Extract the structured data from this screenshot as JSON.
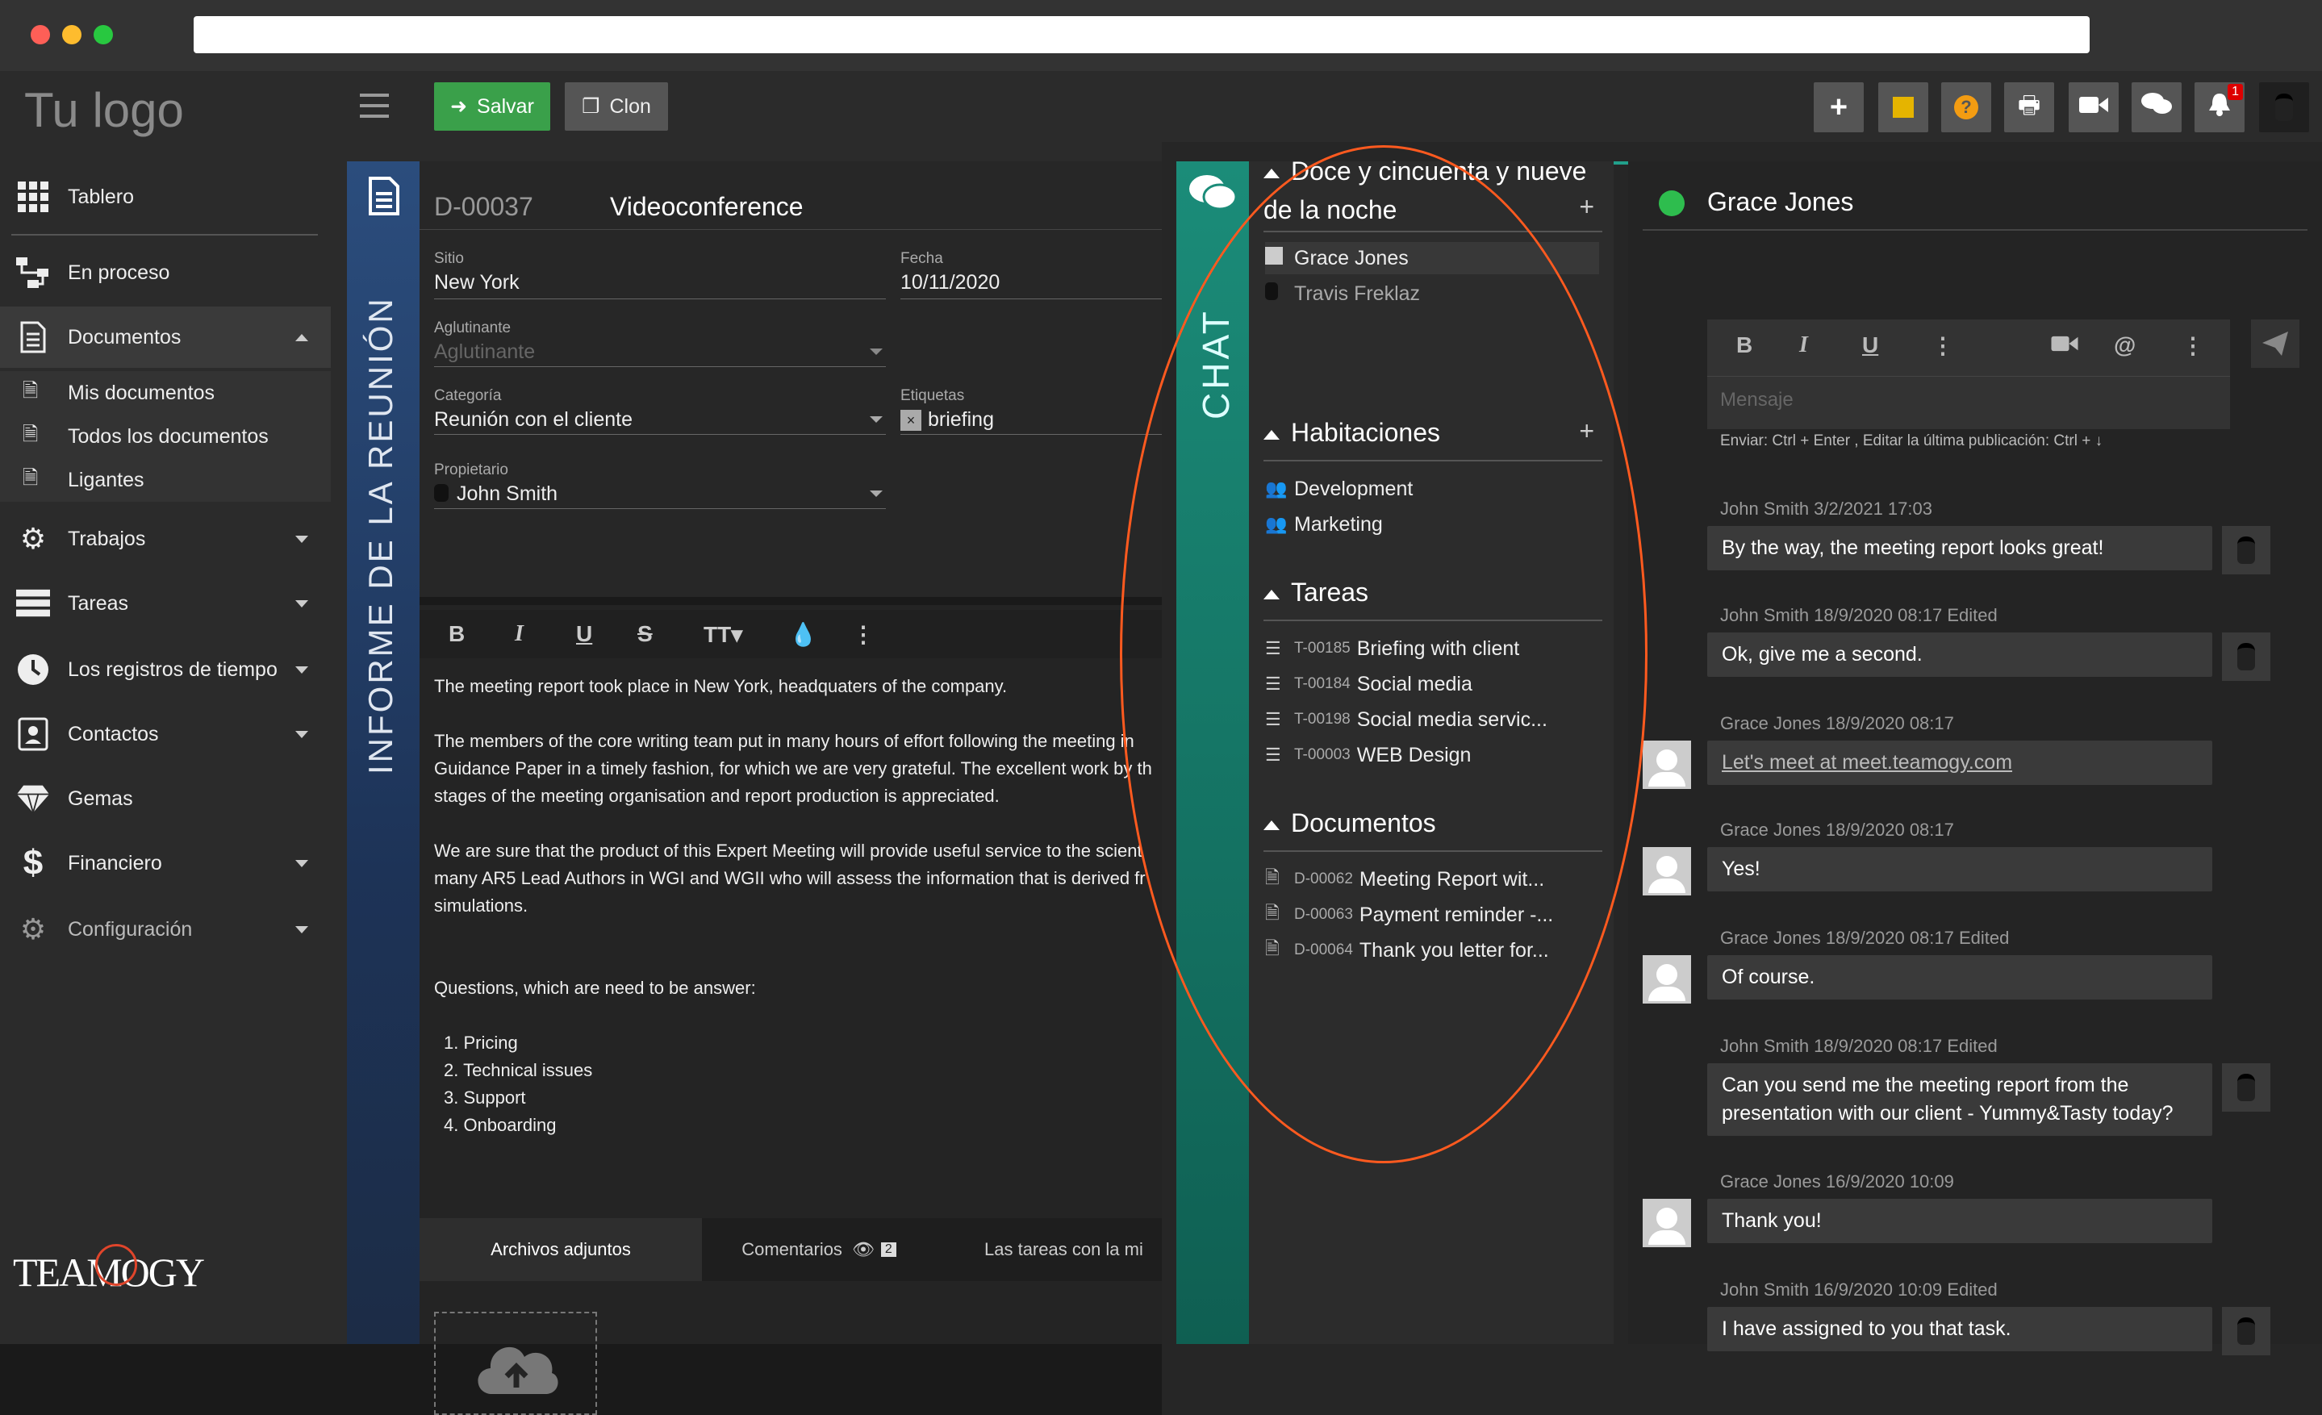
{
  "logo": "Tu logo",
  "brand": "TEAMOGY",
  "nav": {
    "tablero": "Tablero",
    "en_proceso": "En proceso",
    "documentos": "Documentos",
    "mis_documentos": "Mis documentos",
    "todos": "Todos los documentos",
    "ligantes": "Ligantes",
    "trabajos": "Trabajos",
    "tareas": "Tareas",
    "registros": "Los registros de tiempo",
    "contactos": "Contactos",
    "gemas": "Gemas",
    "financiero": "Financiero",
    "config": "Configuración"
  },
  "toolbar": {
    "save": "Salvar",
    "clone": "Clon",
    "notif_count": "1"
  },
  "doc": {
    "vertical_title": "INFORME DE LA REUNIÓN",
    "id": "D-00037",
    "title": "Videoconference",
    "sitio_label": "Sitio",
    "sitio": "New York",
    "fecha_label": "Fecha",
    "fecha": "10/11/2020",
    "aglutinante_label": "Aglutinante",
    "aglutinante_ph": "Aglutinante",
    "categoria_label": "Categoría",
    "categoria": "Reunión con el cliente",
    "etiquetas_label": "Etiquetas",
    "etiqueta": "briefing",
    "propietario_label": "Propietario",
    "propietario": "John Smith",
    "p1": "The meeting report took place in New York, headquaters of the company.",
    "p2a": " The members of the core writing team put in many hours of effort following the meeting in",
    "p2b": "Guidance Paper in a timely fashion, for which we are very grateful. The excellent work by th",
    "p2c": "stages of the meeting organisation and report production is appreciated.",
    "p3a": "We are sure that the product of this Expert Meeting will provide useful service to the scient",
    "p3b": "many AR5 Lead Authors in WGI and WGII who will assess the information that is derived fr",
    "p3c": "simulations.",
    "p4": "Questions, which are need to be answer:",
    "list": [
      "1. Pricing",
      "2. Technical issues",
      "3. Support",
      "4. Onboarding"
    ],
    "tab1": "Archivos adjuntos",
    "tab2": "Comentarios",
    "tab2_count": "2",
    "tab3": "Las tareas con la mi"
  },
  "chat": {
    "vertical": "CHAT",
    "dm_title_1": "Doce y cincuenta y nueve",
    "dm_title_2": "de la noche",
    "dms": [
      "Grace Jones",
      "Travis Freklaz"
    ],
    "rooms_title": "Habitaciones",
    "rooms": [
      "Development",
      "Marketing"
    ],
    "tasks_title": "Tareas",
    "tasks": [
      {
        "code": "T-00185",
        "name": "Briefing with client"
      },
      {
        "code": "T-00184",
        "name": "Social media"
      },
      {
        "code": "T-00198",
        "name": "Social media servic..."
      },
      {
        "code": "T-00003",
        "name": "WEB Design"
      }
    ],
    "docs_title": "Documentos",
    "docs": [
      {
        "code": "D-00062",
        "name": "Meeting Report wit..."
      },
      {
        "code": "D-00063",
        "name": "Payment reminder -..."
      },
      {
        "code": "D-00064",
        "name": "Thank you letter for..."
      }
    ],
    "contact": "Grace Jones",
    "placeholder": "Mensaje",
    "hint": "Enviar: Ctrl + Enter , Editar la última publicación: Ctrl + ↓",
    "messages": [
      {
        "meta": "John Smith  3/2/2021  17:03",
        "text": "By the way, the meeting report looks great!"
      },
      {
        "meta": "John Smith  18/9/2020  08:17  Edited",
        "text": "Ok, give me a second."
      },
      {
        "meta": "Grace Jones  18/9/2020  08:17",
        "text": "Let's meet at meet.teamogy.com"
      },
      {
        "meta": "Grace Jones  18/9/2020  08:17",
        "text": "Yes!"
      },
      {
        "meta": "Grace Jones  18/9/2020  08:17  Edited",
        "text": "Of course."
      },
      {
        "meta": "John Smith  18/9/2020  08:17  Edited",
        "text": "Can you send me the meeting report from the presentation with our client - Yummy&Tasty today?"
      },
      {
        "meta": "Grace Jones  16/9/2020  10:09",
        "text": "Thank you!"
      },
      {
        "meta": "John Smith  16/9/2020  10:09  Edited",
        "text": "I have assigned to you that task."
      }
    ]
  }
}
